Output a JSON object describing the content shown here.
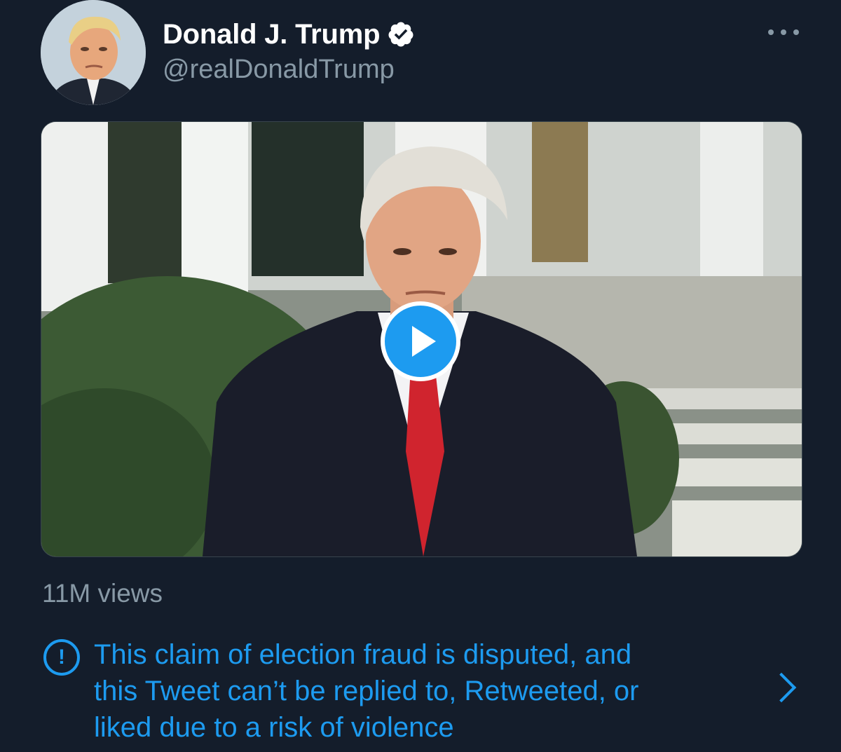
{
  "tweet": {
    "author": {
      "display_name": "Donald J. Trump",
      "handle": "@realDonaldTrump",
      "verified": true,
      "avatar_icon": "profile-photo"
    },
    "more_icon": "ellipsis-icon",
    "media": {
      "type": "video",
      "play_icon": "play-icon"
    },
    "views": "11M views",
    "notice": {
      "icon": "exclamation-circle-icon",
      "text": "This claim of election fraud is disputed, and\nthis Tweet can’t be replied to, Retweeted, or\nliked due to a risk of violence",
      "chevron_icon": "chevron-right-icon"
    }
  },
  "colors": {
    "background": "#141d2b",
    "accent": "#1d9bf0",
    "secondary_text": "#8899a6"
  }
}
